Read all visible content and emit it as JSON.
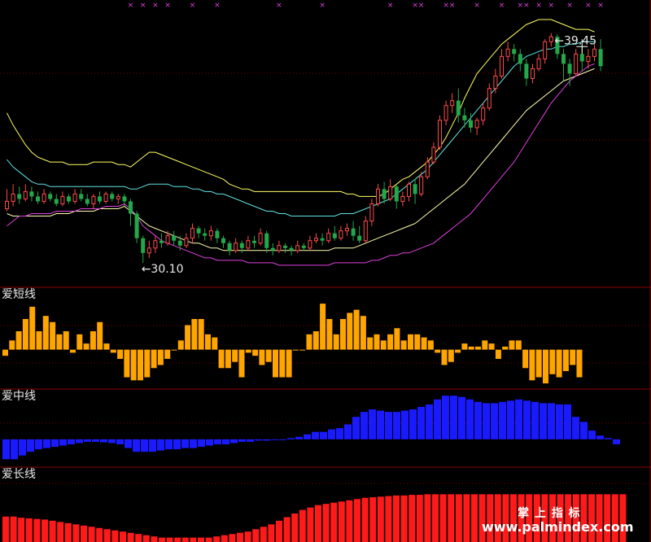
{
  "colors": {
    "background": "#000000",
    "up_candle": "#ff4a4a",
    "down_candle": "#22a84a",
    "band_upper": "#ffff66",
    "band_mid": "#5fe3e3",
    "band_lower_inner": "#ffffb0",
    "band_lower": "#e040e0",
    "short_bar": "#ffa500",
    "mid_bar": "#1a1aff",
    "long_bar": "#ff1a1a",
    "panel_line": "#8b0000",
    "grid": "#7a0000",
    "marker": "#e040e0"
  },
  "annotations": {
    "high_label": "39.45",
    "low_label": "30.10"
  },
  "panels": {
    "short_title": "爱短线",
    "mid_title": "爱中线",
    "long_title": "爱长线"
  },
  "watermark": {
    "cn_text": "掌 上 指 标",
    "url_text": "www.palmindex.com"
  },
  "chart_data": [
    {
      "type": "candlestick",
      "title": "",
      "ylim": [
        29.6,
        40.2
      ],
      "high": 39.45,
      "low": 30.1,
      "candles": [
        [
          32.3,
          32.6,
          33.1,
          32.2
        ],
        [
          32.6,
          32.9,
          33.3,
          32.4
        ],
        [
          32.9,
          32.7,
          33.2,
          32.5
        ],
        [
          32.7,
          33.0,
          33.3,
          32.6
        ],
        [
          33.0,
          32.8,
          33.2,
          32.6
        ],
        [
          32.8,
          32.6,
          33.0,
          32.5
        ],
        [
          32.6,
          32.9,
          33.1,
          32.5
        ],
        [
          32.9,
          32.7,
          33.0,
          32.6
        ],
        [
          32.7,
          32.5,
          32.9,
          32.4
        ],
        [
          32.5,
          32.8,
          33.0,
          32.4
        ],
        [
          32.8,
          32.6,
          32.9,
          32.5
        ],
        [
          32.6,
          32.9,
          33.1,
          32.5
        ],
        [
          32.9,
          32.7,
          33.1,
          32.6
        ],
        [
          32.7,
          32.5,
          32.9,
          32.4
        ],
        [
          32.5,
          32.8,
          32.9,
          32.3
        ],
        [
          32.8,
          32.6,
          33.0,
          32.5
        ],
        [
          32.6,
          32.9,
          33.0,
          32.5
        ],
        [
          32.9,
          32.7,
          33.0,
          32.6
        ],
        [
          32.7,
          32.8,
          32.9,
          32.5
        ],
        [
          32.8,
          32.6,
          32.9,
          32.4
        ],
        [
          32.6,
          32.1,
          32.7,
          31.6
        ],
        [
          32.1,
          31.1,
          32.2,
          30.9
        ],
        [
          31.1,
          30.5,
          31.2,
          30.1
        ],
        [
          30.5,
          30.7,
          31.0,
          30.3
        ],
        [
          30.7,
          31.0,
          31.2,
          30.5
        ],
        [
          31.0,
          30.9,
          31.3,
          30.7
        ],
        [
          30.9,
          31.2,
          31.4,
          30.8
        ],
        [
          31.2,
          31.0,
          31.4,
          30.8
        ],
        [
          31.0,
          30.8,
          31.2,
          30.6
        ],
        [
          30.8,
          31.1,
          31.3,
          30.7
        ],
        [
          31.1,
          31.5,
          31.7,
          30.9
        ],
        [
          31.5,
          31.3,
          31.6,
          31.1
        ],
        [
          31.3,
          31.2,
          31.5,
          31.0
        ],
        [
          31.2,
          31.4,
          31.6,
          31.0
        ],
        [
          31.4,
          31.1,
          31.5,
          30.9
        ],
        [
          31.1,
          30.9,
          31.2,
          30.7
        ],
        [
          30.9,
          30.6,
          31.0,
          30.4
        ],
        [
          30.6,
          30.9,
          31.1,
          30.5
        ],
        [
          30.9,
          30.7,
          31.0,
          30.5
        ],
        [
          30.7,
          31.0,
          31.2,
          30.6
        ],
        [
          31.0,
          30.9,
          31.2,
          30.7
        ],
        [
          30.9,
          31.3,
          31.5,
          30.8
        ],
        [
          31.3,
          30.7,
          31.4,
          30.5
        ],
        [
          30.7,
          30.6,
          30.9,
          30.4
        ],
        [
          30.6,
          30.8,
          31.0,
          30.5
        ],
        [
          30.8,
          30.7,
          30.9,
          30.5
        ],
        [
          30.7,
          30.6,
          30.8,
          30.4
        ],
        [
          30.6,
          30.8,
          31.0,
          30.5
        ],
        [
          30.8,
          30.7,
          30.9,
          30.6
        ],
        [
          30.7,
          31.0,
          31.2,
          30.6
        ],
        [
          31.0,
          31.1,
          31.3,
          30.9
        ],
        [
          31.1,
          31.0,
          31.3,
          30.8
        ],
        [
          31.0,
          31.3,
          31.5,
          30.9
        ],
        [
          31.3,
          31.1,
          31.6,
          31.0
        ],
        [
          31.1,
          31.4,
          31.6,
          31.0
        ],
        [
          31.4,
          31.5,
          31.7,
          31.2
        ],
        [
          31.5,
          31.2,
          31.8,
          31.0
        ],
        [
          31.2,
          31.0,
          31.6,
          30.9
        ],
        [
          31.0,
          31.8,
          32.0,
          30.9
        ],
        [
          31.8,
          32.5,
          32.7,
          31.6
        ],
        [
          32.5,
          33.1,
          33.3,
          32.4
        ],
        [
          33.1,
          32.7,
          33.4,
          32.5
        ],
        [
          32.7,
          33.2,
          33.5,
          32.6
        ],
        [
          33.2,
          32.6,
          33.3,
          32.3
        ],
        [
          32.6,
          32.8,
          33.0,
          32.4
        ],
        [
          32.8,
          33.3,
          33.4,
          32.6
        ],
        [
          33.3,
          32.9,
          33.5,
          32.5
        ],
        [
          32.9,
          33.6,
          33.8,
          32.8
        ],
        [
          33.6,
          34.2,
          34.4,
          33.5
        ],
        [
          34.2,
          34.8,
          35.0,
          34.1
        ],
        [
          34.8,
          35.9,
          36.1,
          34.7
        ],
        [
          35.9,
          36.5,
          36.7,
          35.7
        ],
        [
          36.5,
          36.7,
          37.0,
          36.2
        ],
        [
          36.7,
          36.1,
          37.2,
          35.8
        ],
        [
          36.1,
          35.9,
          36.4,
          35.6
        ],
        [
          35.9,
          35.6,
          36.2,
          35.4
        ],
        [
          35.6,
          35.9,
          36.0,
          35.3
        ],
        [
          35.9,
          36.4,
          36.6,
          35.7
        ],
        [
          36.4,
          37.2,
          37.4,
          36.3
        ],
        [
          37.2,
          37.7,
          38.0,
          37.0
        ],
        [
          37.7,
          38.5,
          38.8,
          37.6
        ],
        [
          38.5,
          38.8,
          39.1,
          38.3
        ],
        [
          38.8,
          38.6,
          39.0,
          38.3
        ],
        [
          38.6,
          38.2,
          38.8,
          37.9
        ],
        [
          38.2,
          37.6,
          38.4,
          37.3
        ],
        [
          37.6,
          38.0,
          38.2,
          37.4
        ],
        [
          38.0,
          38.4,
          38.6,
          37.9
        ],
        [
          38.4,
          39.1,
          39.2,
          38.2
        ],
        [
          39.1,
          39.3,
          39.45,
          38.9
        ],
        [
          39.3,
          38.6,
          39.4,
          38.4
        ],
        [
          38.6,
          38.2,
          38.8,
          37.5
        ],
        [
          38.2,
          37.8,
          38.4,
          37.3
        ],
        [
          37.8,
          38.6,
          38.8,
          37.7
        ],
        [
          38.6,
          38.3,
          38.9,
          37.9
        ],
        [
          38.3,
          38.5,
          38.8,
          38.0
        ],
        [
          38.5,
          38.8,
          39.0,
          38.3
        ],
        [
          38.8,
          38.1,
          39.2,
          37.9
        ]
      ],
      "band_upper": [
        36.2,
        35.7,
        35.3,
        34.9,
        34.6,
        34.4,
        34.3,
        34.2,
        34.2,
        34.2,
        34.1,
        34.1,
        34.1,
        34.1,
        34.2,
        34.2,
        34.2,
        34.2,
        34.1,
        34.1,
        34.0,
        34.2,
        34.4,
        34.6,
        34.6,
        34.5,
        34.4,
        34.3,
        34.2,
        34.1,
        34.0,
        33.9,
        33.8,
        33.7,
        33.6,
        33.5,
        33.3,
        33.2,
        33.1,
        33.1,
        33.0,
        33.0,
        33.0,
        33.0,
        33.0,
        33.0,
        33.0,
        33.0,
        33.0,
        33.0,
        33.0,
        33.0,
        33.0,
        33.0,
        33.0,
        32.9,
        32.9,
        32.8,
        32.8,
        32.8,
        32.8,
        32.9,
        33.1,
        33.3,
        33.5,
        33.6,
        33.8,
        34.0,
        34.2,
        34.5,
        34.8,
        35.2,
        35.7,
        36.2,
        36.8,
        37.3,
        37.8,
        38.1,
        38.4,
        38.7,
        39.0,
        39.2,
        39.4,
        39.6,
        39.8,
        39.9,
        40.0,
        40.0,
        40.0,
        39.9,
        39.8,
        39.7,
        39.6,
        39.6,
        39.6,
        39.5
      ],
      "band_mid": [
        34.3,
        34.0,
        33.8,
        33.6,
        33.4,
        33.3,
        33.3,
        33.2,
        33.2,
        33.2,
        33.2,
        33.2,
        33.2,
        33.2,
        33.2,
        33.2,
        33.2,
        33.2,
        33.2,
        33.2,
        33.1,
        33.1,
        33.2,
        33.3,
        33.3,
        33.3,
        33.3,
        33.2,
        33.2,
        33.2,
        33.1,
        33.1,
        33.0,
        33.0,
        32.9,
        32.9,
        32.8,
        32.7,
        32.6,
        32.5,
        32.4,
        32.3,
        32.2,
        32.2,
        32.1,
        32.1,
        32.0,
        32.0,
        32.0,
        32.0,
        32.0,
        32.0,
        32.0,
        32.0,
        32.1,
        32.1,
        32.1,
        32.2,
        32.3,
        32.4,
        32.5,
        32.6,
        32.7,
        32.9,
        33.1,
        33.3,
        33.5,
        33.7,
        33.9,
        34.2,
        34.5,
        34.8,
        35.1,
        35.4,
        35.7,
        36.0,
        36.3,
        36.6,
        36.9,
        37.2,
        37.5,
        37.8,
        38.1,
        38.3,
        38.5,
        38.6,
        38.7,
        38.8,
        38.8,
        38.9,
        38.9,
        39.0,
        39.0,
        39.1,
        39.1,
        39.1
      ],
      "band_lower_inner": [
        32.1,
        32.0,
        32.0,
        32.0,
        32.0,
        32.0,
        32.0,
        32.0,
        32.1,
        32.1,
        32.1,
        32.2,
        32.2,
        32.2,
        32.2,
        32.3,
        32.3,
        32.3,
        32.3,
        32.4,
        32.2,
        32.0,
        31.8,
        31.6,
        31.5,
        31.4,
        31.3,
        31.2,
        31.1,
        31.0,
        30.9,
        30.9,
        30.8,
        30.7,
        30.7,
        30.6,
        30.6,
        30.6,
        30.6,
        30.6,
        30.6,
        30.6,
        30.6,
        30.6,
        30.6,
        30.6,
        30.6,
        30.6,
        30.6,
        30.6,
        30.6,
        30.6,
        30.6,
        30.7,
        30.7,
        30.7,
        30.7,
        30.8,
        30.9,
        31.0,
        31.1,
        31.2,
        31.3,
        31.4,
        31.5,
        31.6,
        31.7,
        31.9,
        32.1,
        32.3,
        32.5,
        32.7,
        32.9,
        33.1,
        33.3,
        33.6,
        33.9,
        34.2,
        34.5,
        34.8,
        35.1,
        35.4,
        35.7,
        36.0,
        36.3,
        36.5,
        36.7,
        36.9,
        37.1,
        37.3,
        37.5,
        37.6,
        37.7,
        37.8,
        37.9,
        38.0
      ],
      "band_lower": [
        31.6,
        31.8,
        32.0,
        32.0,
        32.1,
        32.1,
        32.1,
        32.1,
        32.2,
        32.2,
        32.2,
        32.2,
        32.3,
        32.3,
        32.3,
        32.3,
        32.4,
        32.4,
        32.4,
        32.5,
        32.3,
        32.0,
        31.6,
        31.4,
        31.2,
        31.0,
        30.9,
        30.8,
        30.7,
        30.6,
        30.5,
        30.4,
        30.3,
        30.3,
        30.2,
        30.2,
        30.2,
        30.2,
        30.2,
        30.1,
        30.1,
        30.1,
        30.1,
        30.1,
        30.0,
        30.0,
        30.0,
        30.0,
        30.0,
        30.0,
        30.0,
        30.0,
        30.0,
        30.1,
        30.1,
        30.1,
        30.1,
        30.1,
        30.1,
        30.2,
        30.2,
        30.3,
        30.4,
        30.4,
        30.5,
        30.5,
        30.6,
        30.7,
        30.8,
        30.9,
        31.1,
        31.3,
        31.5,
        31.7,
        31.9,
        32.1,
        32.4,
        32.7,
        33.0,
        33.3,
        33.6,
        33.9,
        34.2,
        34.6,
        35.0,
        35.4,
        35.8,
        36.2,
        36.6,
        36.9,
        37.2,
        37.5,
        37.7,
        37.9,
        38.1,
        38.2
      ],
      "markers": [
        20,
        22,
        24,
        26,
        30,
        34,
        44,
        51,
        62,
        66,
        67,
        71,
        72,
        76,
        80,
        83,
        84,
        86,
        88,
        91,
        94,
        96
      ]
    },
    {
      "type": "bar",
      "title": "爱短线",
      "ylim": [
        -1.15,
        1.45
      ],
      "values": [
        -0.2,
        0.3,
        0.6,
        1.0,
        1.4,
        0.6,
        1.1,
        0.9,
        0.5,
        0.6,
        -0.1,
        0.5,
        0.2,
        0.6,
        0.9,
        0.2,
        -0.1,
        -0.3,
        -0.9,
        -1.0,
        -1.0,
        -0.9,
        -0.6,
        -0.5,
        -0.3,
        0,
        0.3,
        0.8,
        1.0,
        1.0,
        0.5,
        0.4,
        -0.6,
        -0.6,
        -0.4,
        -0.9,
        -0.1,
        -0.2,
        -0.5,
        -0.4,
        -0.9,
        -0.9,
        -0.9,
        0,
        0,
        0.5,
        0.6,
        1.5,
        1.0,
        0.5,
        1.0,
        1.2,
        1.3,
        1.1,
        0.4,
        0.5,
        0.3,
        0.5,
        0.7,
        0.3,
        0.5,
        0.5,
        0.4,
        0.3,
        -0.1,
        -0.5,
        -0.4,
        -0.1,
        0.2,
        0.1,
        0.1,
        0.3,
        0.2,
        -0.3,
        0.1,
        0.3,
        0.3,
        -0.6,
        -1.0,
        -0.9,
        -1.1,
        -0.8,
        -0.9,
        -0.7,
        -0.5,
        -0.9
      ]
    },
    {
      "type": "bar",
      "title": "爱中线",
      "ylim": [
        -1.05,
        1.3
      ],
      "values": [
        -0.8,
        -0.8,
        -0.65,
        -0.5,
        -0.4,
        -0.35,
        -0.3,
        -0.25,
        -0.2,
        -0.15,
        -0.1,
        -0.1,
        -0.12,
        -0.15,
        -0.2,
        -0.35,
        -0.5,
        -0.5,
        -0.5,
        -0.45,
        -0.4,
        -0.4,
        -0.35,
        -0.35,
        -0.3,
        -0.25,
        -0.2,
        -0.2,
        -0.15,
        -0.1,
        -0.1,
        -0.05,
        -0.05,
        0,
        0,
        0.05,
        0.1,
        0.2,
        0.3,
        0.3,
        0.4,
        0.45,
        0.6,
        0.9,
        1.1,
        1.2,
        1.15,
        1.1,
        1.1,
        1.15,
        1.2,
        1.3,
        1.4,
        1.6,
        1.75,
        1.75,
        1.7,
        1.6,
        1.5,
        1.45,
        1.45,
        1.5,
        1.55,
        1.6,
        1.55,
        1.5,
        1.45,
        1.45,
        1.4,
        1.4,
        0.9,
        0.7,
        0.35,
        0.15,
        0.05,
        -0.2
      ]
    },
    {
      "type": "bar",
      "title": "爱长线",
      "ylim": [
        0,
        1.0
      ],
      "values": [
        0.45,
        0.45,
        0.43,
        0.42,
        0.41,
        0.4,
        0.38,
        0.36,
        0.34,
        0.32,
        0.3,
        0.28,
        0.26,
        0.24,
        0.22,
        0.2,
        0.18,
        0.16,
        0.14,
        0.12,
        0.1,
        0.1,
        0.1,
        0.1,
        0.1,
        0.1,
        0.1,
        0.12,
        0.14,
        0.16,
        0.18,
        0.2,
        0.24,
        0.28,
        0.32,
        0.38,
        0.44,
        0.5,
        0.56,
        0.6,
        0.64,
        0.66,
        0.68,
        0.7,
        0.72,
        0.74,
        0.76,
        0.77,
        0.78,
        0.79,
        0.8,
        0.8,
        0.81,
        0.81,
        0.82,
        0.82,
        0.82,
        0.82,
        0.82,
        0.82,
        0.82,
        0.82,
        0.82,
        0.82,
        0.82,
        0.82,
        0.82,
        0.82,
        0.82,
        0.82,
        0.82,
        0.82,
        0.82,
        0.82,
        0.82,
        0.82,
        0.82,
        0.82,
        0.82,
        0.82
      ]
    }
  ]
}
